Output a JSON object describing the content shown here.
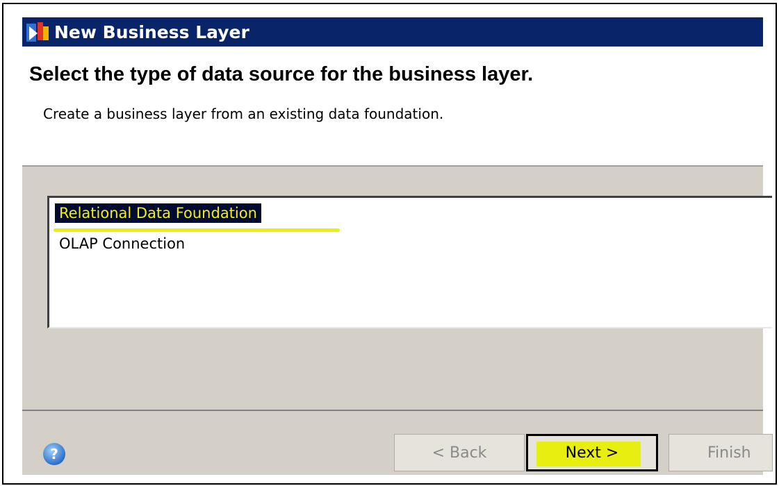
{
  "window": {
    "title": "New Business Layer"
  },
  "header": {
    "heading": "Select the type of data source for the business layer.",
    "subheading": "Create a business layer from an existing data foundation."
  },
  "list": {
    "items": [
      {
        "label": "Relational Data Foundation",
        "selected": true
      },
      {
        "label": "OLAP Connection",
        "selected": false
      }
    ]
  },
  "footer": {
    "help_icon": "help-icon",
    "back_label": "< Back",
    "next_label": "Next >",
    "finish_label": "Finish"
  },
  "colors": {
    "titlebar": "#0a246a",
    "selection_bg": "#000a30",
    "selection_text": "#f4f000",
    "highlight": "#e8f010",
    "panel": "#d4d0c8"
  }
}
